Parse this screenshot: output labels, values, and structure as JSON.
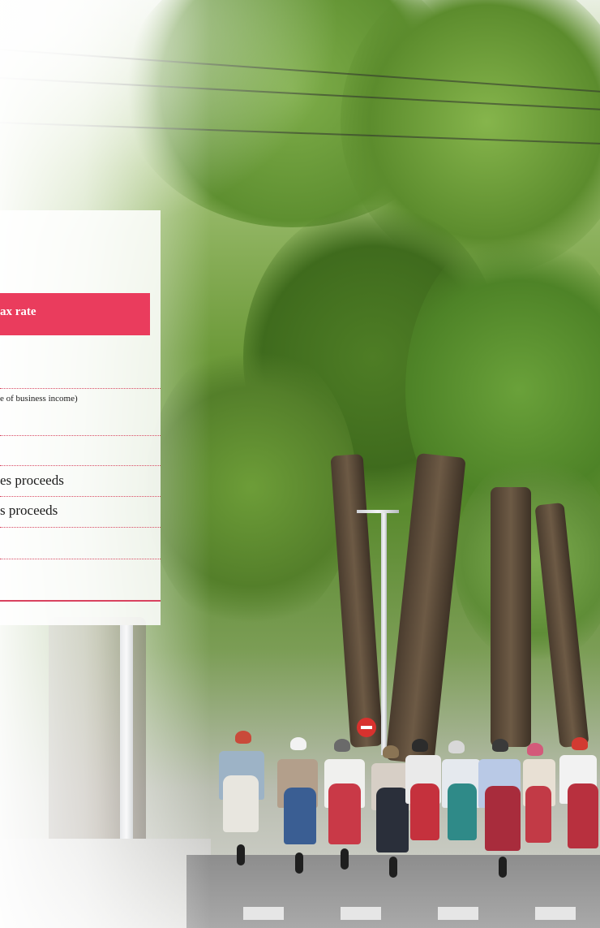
{
  "panel": {
    "header_label": "ax rate",
    "rows": [
      "",
      "e of business income)",
      "",
      "es proceeds",
      "s proceeds",
      ""
    ]
  },
  "colors": {
    "accent": "#ea3c5d",
    "panel_background": "#ffffff"
  }
}
